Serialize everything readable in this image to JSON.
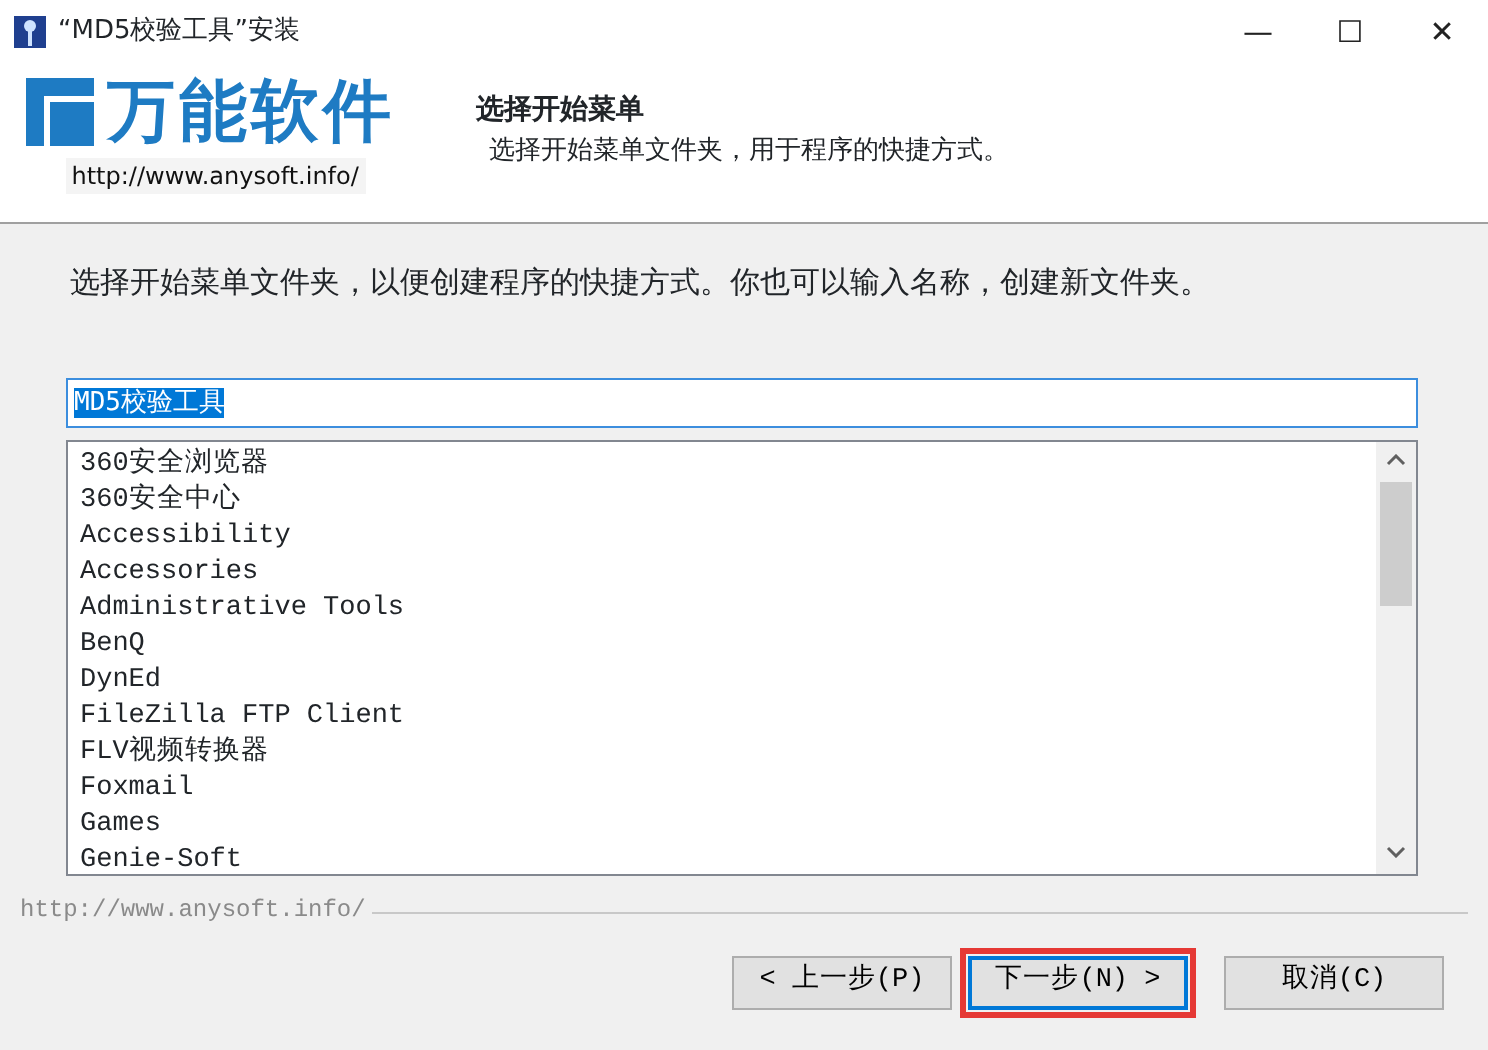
{
  "window": {
    "title": "“MD5校验工具”安装",
    "controls": [
      "—",
      "☐",
      "✕"
    ]
  },
  "banner": {
    "logo_text": "万能软件",
    "logo_url": "http://www.anysoft.info/"
  },
  "header": {
    "title": "选择开始菜单",
    "subtitle": "选择开始菜单文件夹，用于程序的快捷方式。"
  },
  "instructions": "选择开始菜单文件夹，以便创建程序的快捷方式。你也可以输入名称，创建新文件夹。",
  "folder_field": {
    "value": "MD5校验工具",
    "text_selected": true
  },
  "folders": [
    "360安全浏览器",
    "360安全中心",
    "Accessibility",
    "Accessories",
    "Administrative Tools",
    "BenQ",
    "DynEd",
    "FileZilla FTP Client",
    "FLV视频转换器",
    "Foxmail",
    "Games",
    "Genie-Soft"
  ],
  "footer_brand": "http://www.anysoft.info/",
  "buttons": [
    {
      "label": "< 上一步(P)",
      "focused": false,
      "highlighted": false
    },
    {
      "label": "下一步(N) >",
      "focused": true,
      "highlighted": true
    },
    {
      "label": "取消(C)",
      "focused": false,
      "highlighted": false
    }
  ]
}
